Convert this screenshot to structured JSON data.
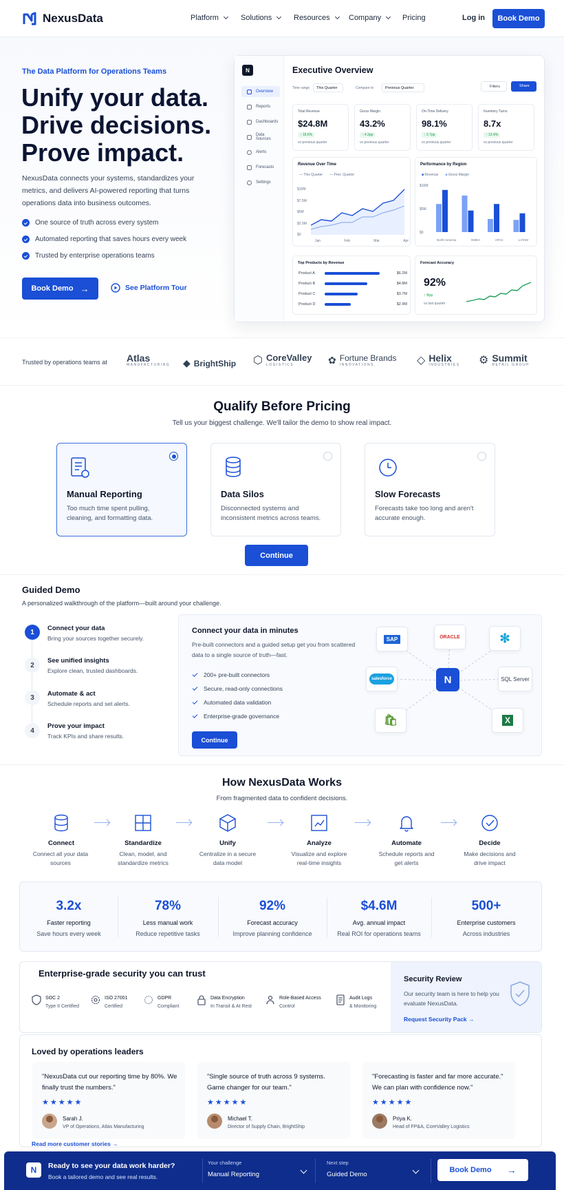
{
  "nav": {
    "brand": "NexusData",
    "links": [
      {
        "label": "Platform"
      },
      {
        "label": "Solutions"
      },
      {
        "label": "Resources"
      },
      {
        "label": "Company"
      },
      {
        "label": "Pricing"
      }
    ],
    "login": "Log in",
    "cta": "Book Demo"
  },
  "hero": {
    "eyebrow": "The Data Platform for Operations Teams",
    "headline": [
      "Unify your data.",
      "Drive decisions.",
      "Prove impact."
    ],
    "body": "NexusData connects your systems, standardizes your metrics, and delivers AI-powered reporting that turns operations data into business outcomes.",
    "bullets": [
      "One source of truth across every system",
      "Automated reporting that saves hours every week",
      "Trusted by enterprise operations teams"
    ],
    "cta_primary": "Book Demo",
    "cta_secondary": "See Platform Tour"
  },
  "dashboard": {
    "title": "Executive Overview",
    "sidebar": [
      "Overview",
      "Reports",
      "Dashboards",
      "Data Sources",
      "Alerts",
      "Forecasts",
      "Settings"
    ],
    "time_range_label": "Time range",
    "time_range_value": "This Quarter",
    "compare_label": "Compare to",
    "compare_value": "Previous Quarter",
    "filters": "Filters",
    "share": "Share",
    "kpis": [
      {
        "title": "Total Revenue",
        "value": "$24.8M",
        "delta": "↑ 18.6%",
        "sub": "vs previous quarter"
      },
      {
        "title": "Gross Margin",
        "value": "43.2%",
        "delta": "↑ 4.3pp",
        "sub": "vs previous quarter"
      },
      {
        "title": "On-Time Delivery",
        "value": "98.1%",
        "delta": "↑ 2.7pp",
        "sub": "vs previous quarter"
      },
      {
        "title": "Inventory Turns",
        "value": "8.7x",
        "delta": "↑ 13.4%",
        "sub": "vs previous quarter"
      }
    ],
    "revenue_chart": {
      "title": "Revenue Over Time",
      "legend": [
        "This Quarter",
        "Prev. Quarter"
      ],
      "y_ticks": [
        "$10M",
        "$7.5M",
        "$5M",
        "$2.5M",
        "$0"
      ],
      "x_ticks": [
        "Jan",
        "Feb",
        "Mar",
        "Apr"
      ]
    },
    "region_chart": {
      "title": "Performance by Region",
      "legend": [
        "Revenue",
        "Gross Margin"
      ],
      "y_ticks": [
        "$10M",
        "$5M",
        "$0"
      ],
      "regions": [
        "North America",
        "EMEA",
        "APAC",
        "LATAM"
      ],
      "revenue": [
        9.0,
        4.6,
        6.0,
        4.0
      ],
      "margin": [
        6.0,
        7.8,
        2.8,
        2.6
      ]
    },
    "products": {
      "title": "Top Products by Revenue",
      "items": [
        {
          "name": "Product A",
          "value": "$6.2M",
          "share": 1.0
        },
        {
          "name": "Product B",
          "value": "$4.8M",
          "share": 0.77
        },
        {
          "name": "Product C",
          "value": "$3.7M",
          "share": 0.6
        },
        {
          "name": "Product D",
          "value": "$2.9M",
          "share": 0.47
        }
      ]
    },
    "forecast": {
      "title": "Forecast Accuracy",
      "value": "92%",
      "delta": "↑ 8pp",
      "sub": "vs last quarter"
    }
  },
  "logos": {
    "label": "Trusted by operations teams at",
    "items": [
      {
        "name": "Atlas",
        "sub": "MANUFACTURING"
      },
      {
        "name": "BrightShip",
        "sub": ""
      },
      {
        "name": "CoreValley",
        "sub": "LOGISTICS"
      },
      {
        "name": "Fortune Brands",
        "sub": "INNOVATIONS"
      },
      {
        "name": "Helix",
        "sub": "INDUSTRIES"
      },
      {
        "name": "Summit",
        "sub": "RETAIL GROUP"
      }
    ]
  },
  "qualify": {
    "title": "Qualify Before Pricing",
    "subtitle": "Tell us your biggest challenge. We'll tailor the demo to show real impact.",
    "cards": [
      {
        "title": "Manual Reporting",
        "desc": "Too much time spent pulling, cleaning, and formatting data.",
        "selected": true
      },
      {
        "title": "Data Silos",
        "desc": "Disconnected systems and inconsistent metrics across teams.",
        "selected": false
      },
      {
        "title": "Slow Forecasts",
        "desc": "Forecasts take too long and aren't accurate enough.",
        "selected": false
      }
    ],
    "cta": "Continue"
  },
  "guided": {
    "title": "Guided Demo",
    "subtitle": "A personalized walkthrough of the platform—built around your challenge.",
    "steps": [
      {
        "num": "1",
        "title": "Connect your data",
        "desc": "Bring your sources together securely."
      },
      {
        "num": "2",
        "title": "See unified insights",
        "desc": "Explore clean, trusted dashboards."
      },
      {
        "num": "3",
        "title": "Automate & act",
        "desc": "Schedule reports and set alerts."
      },
      {
        "num": "4",
        "title": "Prove your impact",
        "desc": "Track KPIs and share results."
      }
    ],
    "panel_title": "Connect your data in minutes",
    "panel_body": "Pre-built connectors and a guided setup get you from scattered data to a single source of truth—fast.",
    "checks": [
      "200+ pre-built connectors",
      "Secure, read-only connections",
      "Automated data validation",
      "Enterprise-grade governance"
    ],
    "cta": "Continue",
    "connectors": [
      "SAP",
      "ORACLE",
      "salesforce",
      "SQL Server"
    ]
  },
  "how": {
    "title": "How NexusData Works",
    "subtitle": "From fragmented data to confident decisions.",
    "steps": [
      {
        "title": "Connect",
        "desc": "Connect all your data sources"
      },
      {
        "title": "Standardize",
        "desc": "Clean, model, and standardize metrics"
      },
      {
        "title": "Unify",
        "desc": "Centralize in a secure data model"
      },
      {
        "title": "Analyze",
        "desc": "Visualize and explore real-time insights"
      },
      {
        "title": "Automate",
        "desc": "Schedule reports and get alerts"
      },
      {
        "title": "Decide",
        "desc": "Make decisions and drive impact"
      }
    ]
  },
  "stats": [
    {
      "value": "3.2x",
      "label": "Faster reporting",
      "sub": "Save hours every week"
    },
    {
      "value": "78%",
      "label": "Less manual work",
      "sub": "Reduce repetitive tasks"
    },
    {
      "value": "92%",
      "label": "Forecast accuracy",
      "sub": "Improve planning confidence"
    },
    {
      "value": "$4.6M",
      "label": "Avg. annual impact",
      "sub": "Real ROI for operations teams"
    },
    {
      "value": "500+",
      "label": "Enterprise customers",
      "sub": "Across industries"
    }
  ],
  "security": {
    "title": "Enterprise-grade security you can trust",
    "items": [
      {
        "title": "SOC 2",
        "sub": "Type II Certified"
      },
      {
        "title": "ISO 27001",
        "sub": "Certified"
      },
      {
        "title": "GDPR",
        "sub": "Compliant"
      },
      {
        "title": "Data Encryption",
        "sub": "In Transit & At Rest"
      },
      {
        "title": "Role-Based Access",
        "sub": "Control"
      },
      {
        "title": "Audit Logs",
        "sub": "& Monitoring"
      }
    ],
    "review_title": "Security Review",
    "review_body": "Our security team is here to help you evaluate NexusData.",
    "review_link": "Request Security Pack"
  },
  "testimonials": {
    "title": "Loved by operations leaders",
    "items": [
      {
        "quote": "\"NexusData cut our reporting time by 80%. We finally trust the numbers.\"",
        "stars": "★★★★★",
        "name": "Sarah J.",
        "role": "VP of Operations, Atlas Manufacturing"
      },
      {
        "quote": "\"Single source of truth across 9 systems. Game changer for our team.\"",
        "stars": "★★★★★",
        "name": "Michael T.",
        "role": "Director of Supply Chain, BrightShip"
      },
      {
        "quote": "\"Forecasting is faster and far more accurate.\" We can plan with confidence now.\"",
        "stars": "★★★★★",
        "name": "Priya K.",
        "role": "Head of FP&A, CoreValley Logistics"
      }
    ],
    "more": "Read more customer stories"
  },
  "bottom_bar": {
    "title": "Ready to see your data work harder?",
    "sub": "Book a tailored demo and see real results.",
    "challenge_label": "Your challenge",
    "challenge_value": "Manual Reporting",
    "next_label": "Next step",
    "next_value": "Guided Demo",
    "cta": "Book Demo"
  },
  "colors": {
    "accent": "#1a4fd6",
    "navy": "#0e2d8c",
    "green": "#16a34a"
  }
}
